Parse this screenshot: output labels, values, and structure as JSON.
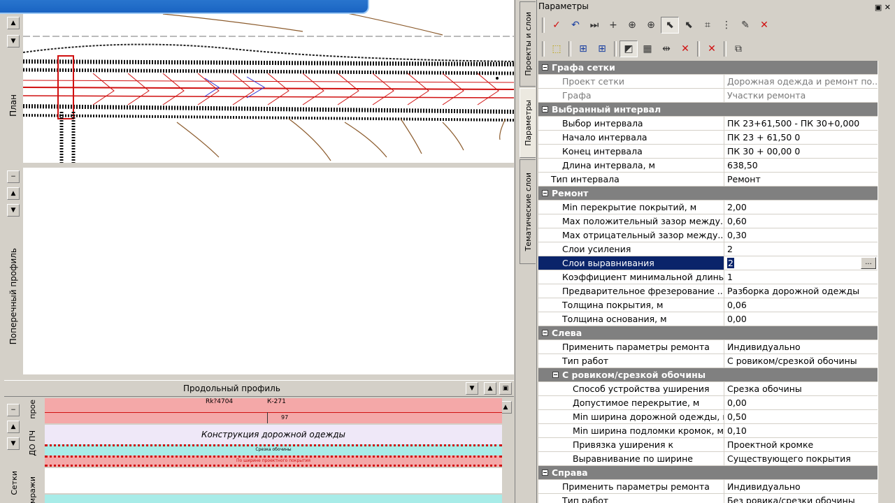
{
  "left": {
    "plan_label": "План",
    "cross_label": "Поперечный профиль",
    "long_title": "Продольный профиль",
    "strip_labels": {
      "proe": "прое",
      "do_pch": "ДО ПЧ",
      "setki": "Сетки",
      "mrazhi": "мражи"
    },
    "strip_texts": {
      "top_a": "Rk?4704",
      "top_b": "К-271",
      "top_num": "97",
      "construction": "Конструкция дорожной одежды",
      "small1": "Срезка обочины",
      "small2": "По ширине проектного покрытия"
    },
    "colors": {
      "pink": "#f4a8a8",
      "cyan": "#a8ece8",
      "lavender": "#efe8f8",
      "red": "#d01010"
    }
  },
  "right": {
    "panel_title": "Параметры",
    "tabs": [
      "Проекты и слои",
      "Параметры",
      "Тематические слои"
    ],
    "active_tab": "Параметры",
    "toolbar1_icons": [
      "checkmark-icon",
      "undo-icon",
      "step-forward-icon",
      "crosshair-icon",
      "target-icon",
      "target-plus-icon",
      "select-cursor-icon",
      "select-arrow-icon",
      "node-icon",
      "split-icon",
      "eyedropper-icon",
      "delete-icon"
    ],
    "toolbar2_icons": [
      "select-rect-icon",
      "add-row-icon",
      "add-row-alt-icon",
      "layers-icon",
      "table-icon",
      "insert-interval-icon",
      "delete-interval-icon",
      "delete-row-icon",
      "export-icon"
    ],
    "grid": [
      {
        "type": "cat",
        "label": "Графа сетки"
      },
      {
        "type": "row",
        "k": "Проект сетки",
        "v": "Дорожная одежда и ремонт по...",
        "dis": true
      },
      {
        "type": "row",
        "k": "Графа",
        "v": "Участки ремонта",
        "dis": true
      },
      {
        "type": "cat",
        "label": "Выбранный интервал"
      },
      {
        "type": "row",
        "k": "Выбор интервала",
        "v": "ПК 23+61,500 - ПК 30+0,000"
      },
      {
        "type": "row",
        "k": "Начало интервала",
        "v": "ПК     23 + 61,50  0"
      },
      {
        "type": "row",
        "k": "Конец интервала",
        "v": "ПК     30 + 00,00  0"
      },
      {
        "type": "row",
        "k": "Длина интервала, м",
        "v": "638,50"
      },
      {
        "type": "row",
        "k": "Тип интервала",
        "v": "Ремонт",
        "lvl": 1
      },
      {
        "type": "cat",
        "label": "Ремонт"
      },
      {
        "type": "row",
        "k": "Min перекрытие покрытий, м",
        "v": "2,00"
      },
      {
        "type": "row",
        "k": "Max положительный зазор между...",
        "v": "0,60"
      },
      {
        "type": "row",
        "k": "Max отрицательный зазор между...",
        "v": "0,30"
      },
      {
        "type": "row",
        "k": "Слои усиления",
        "v": "2"
      },
      {
        "type": "row",
        "k": "Слои выравнивания",
        "v": "2",
        "sel": true
      },
      {
        "type": "row",
        "k": "Коэффициент минимальной длины",
        "v": "1"
      },
      {
        "type": "row",
        "k": "Предварительное фрезерование ...",
        "v": "Разборка дорожной одежды"
      },
      {
        "type": "row",
        "k": "Толщина покрытия, м",
        "v": "0,06"
      },
      {
        "type": "row",
        "k": "Толщина основания, м",
        "v": "0,00"
      },
      {
        "type": "cat",
        "label": "Слева"
      },
      {
        "type": "row",
        "k": "Применить параметры ремонта",
        "v": "Индивидуально"
      },
      {
        "type": "row",
        "k": "Тип работ",
        "v": "С ровиком/срезкой обочины"
      },
      {
        "type": "subcat",
        "label": "С ровиком/срезкой обочины"
      },
      {
        "type": "row",
        "k": "Способ устройства уширения",
        "v": "Срезка обочины",
        "lvl": 3
      },
      {
        "type": "row",
        "k": "Допустимое перекрытие, м",
        "v": "0,00",
        "lvl": 3
      },
      {
        "type": "row",
        "k": "Min ширина дорожной одежды, м",
        "v": "0,50",
        "lvl": 3
      },
      {
        "type": "row",
        "k": "Min ширина подломки кромок, м",
        "v": "0,10",
        "lvl": 3
      },
      {
        "type": "row",
        "k": "Привязка уширения к",
        "v": "Проектной кромке",
        "lvl": 3
      },
      {
        "type": "row",
        "k": "Выравнивание по ширине",
        "v": "Существующего покрытия",
        "lvl": 3
      },
      {
        "type": "cat",
        "label": "Справа"
      },
      {
        "type": "row",
        "k": "Применить параметры ремонта",
        "v": "Индивидуально"
      },
      {
        "type": "row",
        "k": "Тип работ",
        "v": "Без ровика/срезки обочины"
      }
    ],
    "ellipsis": "..."
  }
}
